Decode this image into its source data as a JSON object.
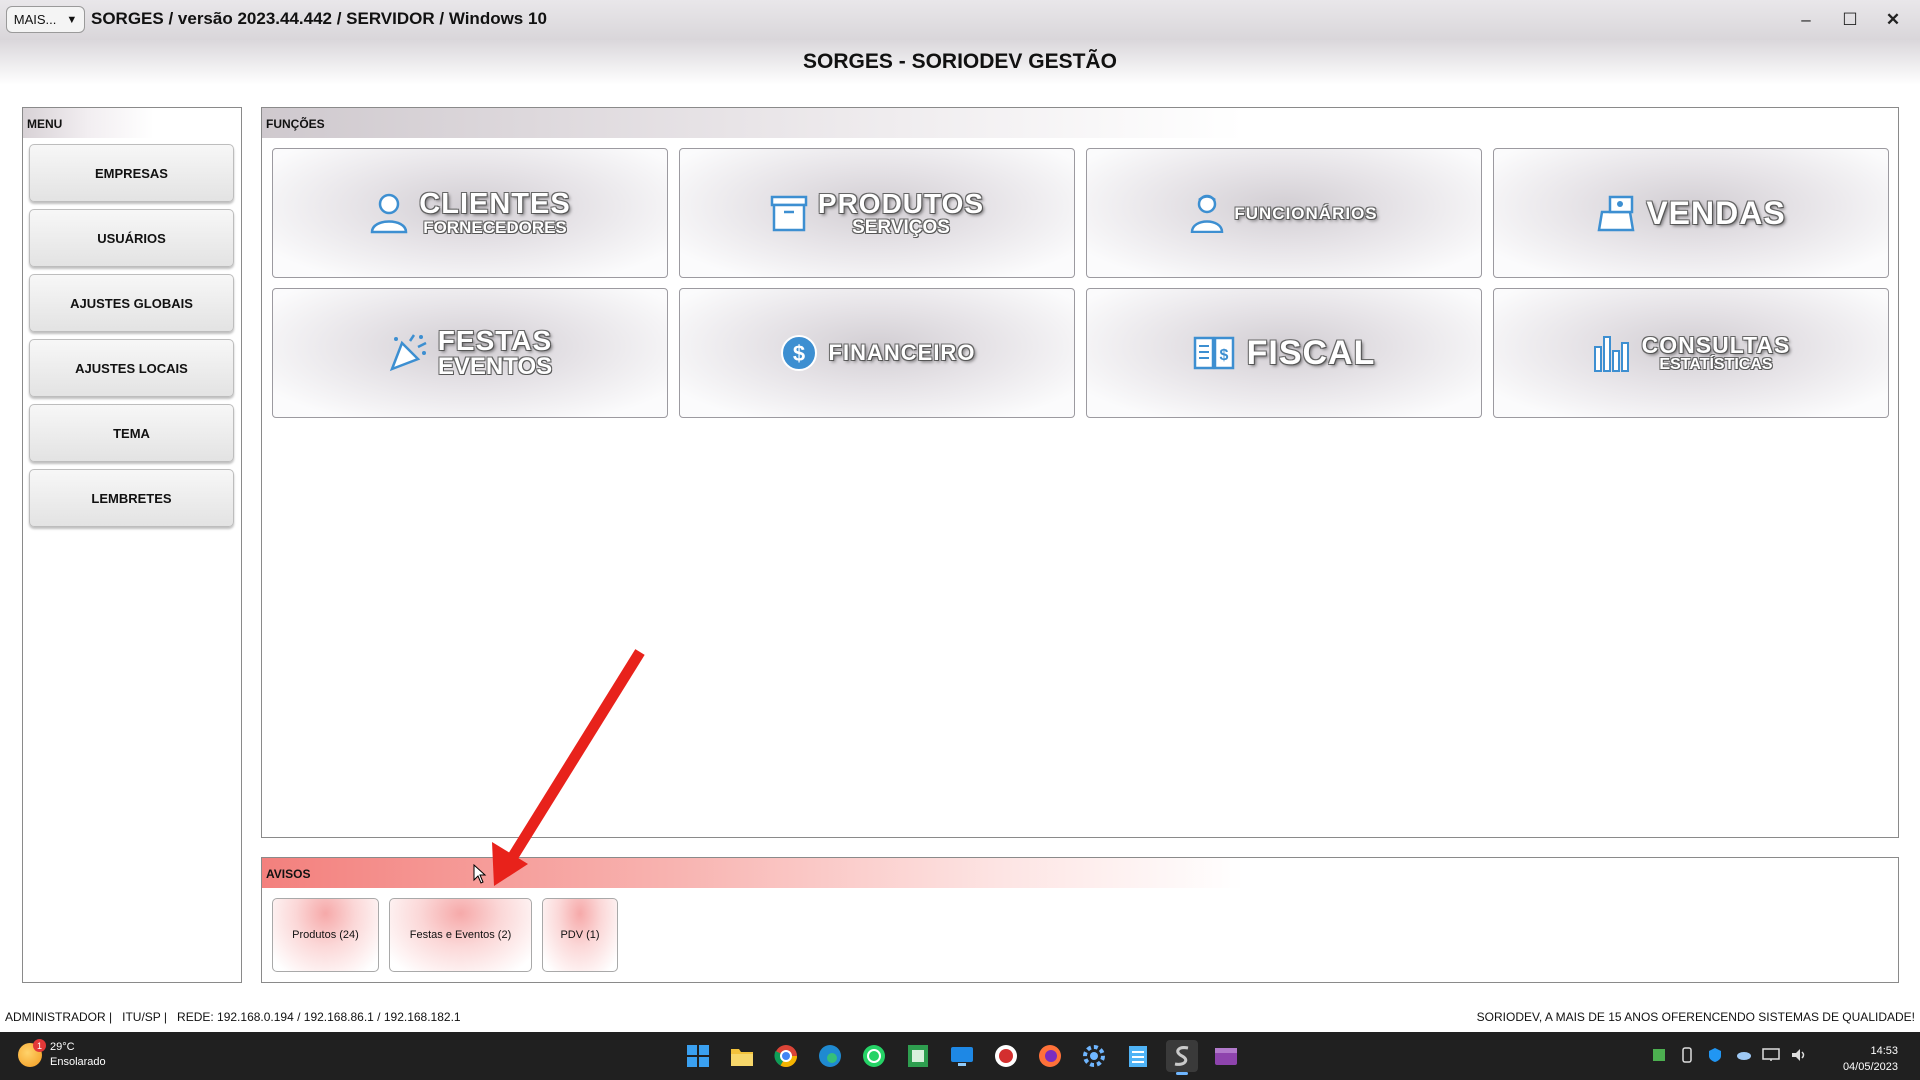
{
  "window": {
    "menu_button": "MAIS...",
    "menu_arrow": "▼",
    "title": "SORGES / versão 2023.44.442 / SERVIDOR / Windows 10",
    "minimize": "–",
    "maximize": "☐",
    "close": "✕"
  },
  "header": {
    "title": "SORGES - SORIODEV GESTÃO"
  },
  "menu": {
    "label": "MENU",
    "items": [
      "EMPRESAS",
      "USUÁRIOS",
      "AJUSTES GLOBAIS",
      "AJUSTES LOCAIS",
      "TEMA",
      "LEMBRETES"
    ]
  },
  "functions": {
    "label": "FUNÇÕES",
    "tiles": [
      {
        "main": "CLIENTES",
        "sub": "FORNECEDORES",
        "icon": "person-icon"
      },
      {
        "main": "PRODUTOS",
        "sub": "SERVIÇOS",
        "icon": "box-icon"
      },
      {
        "main": "FUNCIONÁRIOS",
        "sub": "",
        "icon": "employee-icon"
      },
      {
        "main": "VENDAS",
        "sub": "",
        "icon": "cash-register-icon"
      },
      {
        "main": "FESTAS",
        "sub": "EVENTOS",
        "icon": "party-icon"
      },
      {
        "main": "FINANCEIRO",
        "sub": "",
        "icon": "dollar-icon"
      },
      {
        "main": "FISCAL",
        "sub": "",
        "icon": "document-dollar-icon"
      },
      {
        "main": "CONSULTAS",
        "sub": "ESTATÍSTICAS",
        "icon": "bar-chart-icon"
      }
    ]
  },
  "avisos": {
    "label": "AVISOS",
    "items": [
      "Produtos (24)",
      "Festas e Eventos (2)",
      "PDV (1)"
    ]
  },
  "status": {
    "left": "ADMINISTRADOR |   ITU/SP |   REDE: 192.168.0.194 / 192.168.86.1 / 192.168.182.1",
    "right": "SORIODEV, A MAIS DE 15 ANOS OFERENCENDO SISTEMAS DE QUALIDADE!"
  },
  "taskbar": {
    "weather_temp": "29°C",
    "weather_desc": "Ensolarado",
    "weather_badge": "1",
    "time": "14:53",
    "date": "04/05/2023",
    "apps": [
      "windows-start-icon",
      "file-explorer-icon",
      "chrome-icon",
      "edge-icon",
      "whatsapp-icon",
      "spreadsheet-icon",
      "remote-desktop-icon",
      "app-red-icon",
      "firefox-icon",
      "settings-icon",
      "notepad-icon",
      "sorges-app-icon",
      "video-editor-icon"
    ]
  },
  "colors": {
    "accent_red": "#e8221b",
    "avisos_header": "#f3807d",
    "taskbar": "#202020"
  }
}
